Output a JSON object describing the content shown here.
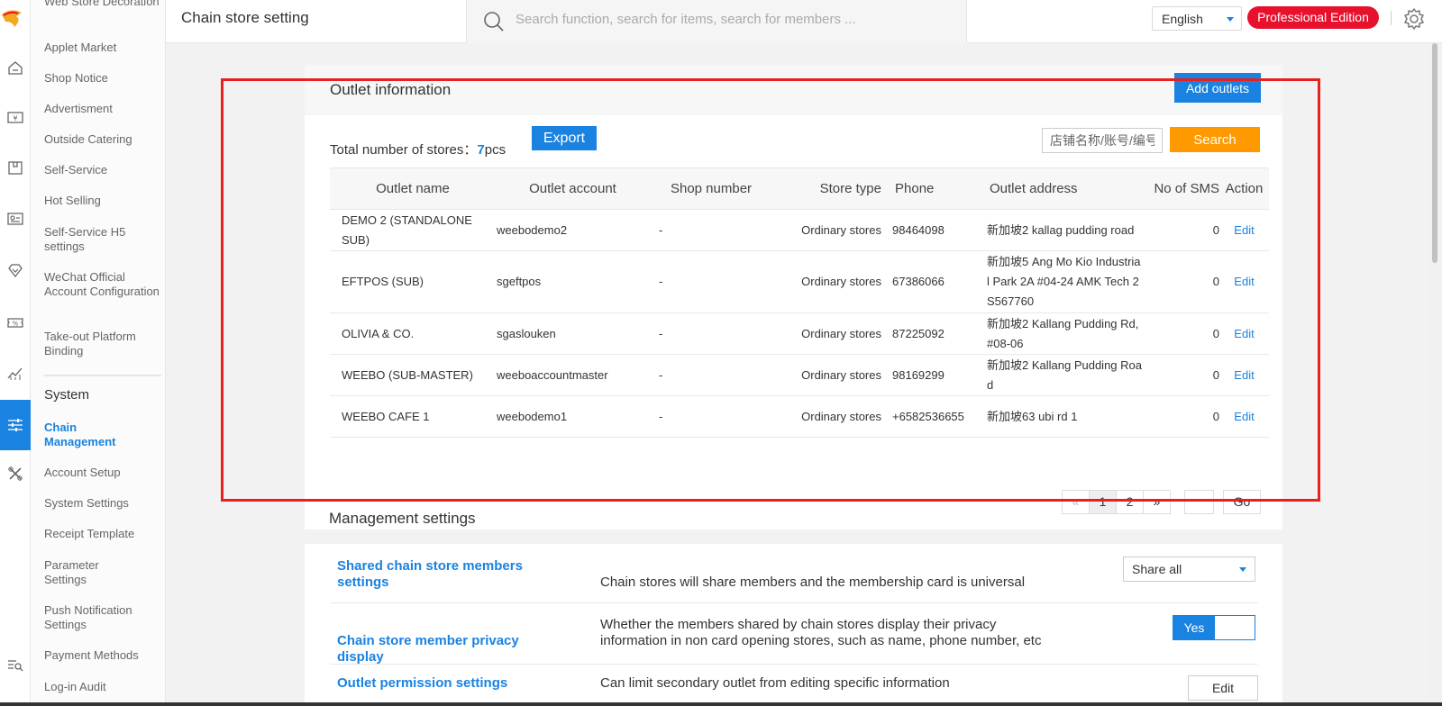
{
  "app": {
    "page_title": "Chain store setting"
  },
  "topbar": {
    "search_placeholder": "Search function, search for items, search for members ...",
    "language": "English",
    "edition": "Professional Edition"
  },
  "sidebar": {
    "items": [
      {
        "label": "Web Store Decoration"
      },
      {
        "label": "Applet Market"
      },
      {
        "label": "Shop Notice"
      },
      {
        "label": "Advertisment"
      },
      {
        "label": "Outside Catering"
      },
      {
        "label": "Self-Service"
      },
      {
        "label": "Hot Selling"
      },
      {
        "label": "Self-Service H5 settings"
      },
      {
        "label": "WeChat Official Account Configuration"
      },
      {
        "label": "Take-out Platform Binding"
      }
    ],
    "section_title": "System",
    "system_items": [
      {
        "label": "Chain Management",
        "active": true
      },
      {
        "label": "Account Setup"
      },
      {
        "label": "System Settings"
      },
      {
        "label": "Receipt Template"
      },
      {
        "label": "Parameter Settings"
      },
      {
        "label": "Push Notification Settings"
      },
      {
        "label": "Payment Methods"
      },
      {
        "label": "Log-in Audit"
      }
    ]
  },
  "outlet_info": {
    "title": "Outlet information",
    "add_button": "Add outlets",
    "total_label": "Total number of stores：",
    "total_count": "7",
    "total_unit": "pcs",
    "export_button": "Export",
    "search_placeholder": "店铺名称/账号/编号",
    "search_button": "Search",
    "columns": [
      "Outlet name",
      "Outlet account",
      "Shop number",
      "Store type",
      "Phone",
      "Outlet address",
      "No of SMS",
      "Action"
    ],
    "rows": [
      {
        "name": "DEMO 2 (STANDALONE SUB)",
        "account": "weebodemo2",
        "shop_no": "-",
        "type": "Ordinary stores",
        "phone": "98464098",
        "address": "新加坡2 kallag pudding road",
        "sms": "0",
        "action": "Edit"
      },
      {
        "name": "EFTPOS (SUB)",
        "account": "sgeftpos",
        "shop_no": "-",
        "type": "Ordinary stores",
        "phone": "67386066",
        "address": "新加坡5 Ang Mo Kio Industrial Park 2A #04-24 AMK Tech 2 S567760",
        "sms": "0",
        "action": "Edit"
      },
      {
        "name": "OLIVIA & CO.",
        "account": "sgaslouken",
        "shop_no": "-",
        "type": "Ordinary stores",
        "phone": "87225092",
        "address": "新加坡2 Kallang Pudding Rd, #08-06",
        "sms": "0",
        "action": "Edit"
      },
      {
        "name": "WEEBO (SUB-MASTER)",
        "account": "weeboaccountmaster",
        "shop_no": "-",
        "type": "Ordinary stores",
        "phone": "98169299",
        "address": "新加坡2 Kallang Pudding Road",
        "sms": "0",
        "action": "Edit"
      },
      {
        "name": "WEEBO CAFE 1",
        "account": "weebodemo1",
        "shop_no": "-",
        "type": "Ordinary stores",
        "phone": "+6582536655",
        "address": "新加坡63 ubi rd 1",
        "sms": "0",
        "action": "Edit"
      }
    ],
    "pagination": {
      "prev": "«",
      "pages": [
        "1",
        "2"
      ],
      "current": "1",
      "next": "»",
      "go": "Go"
    }
  },
  "management": {
    "title": "Management settings",
    "settings": [
      {
        "label": "Shared chain store members settings",
        "desc": "Chain stores will share members and the membership card is universal",
        "control": "Share all"
      },
      {
        "label": "Chain store member privacy display",
        "desc": "Whether the members shared by chain stores display their privacy information in non card opening stores, such as name, phone number, etc",
        "control": "Yes"
      },
      {
        "label": "Outlet permission settings",
        "desc": "Can limit secondary outlet from editing specific information",
        "control": "Edit"
      }
    ]
  },
  "colors": {
    "accent": "#1a82e0",
    "search_orange": "#ff9900",
    "edition_red": "#e8112d",
    "highlight_box": "#e82020"
  },
  "icons": [
    "logo-icon",
    "home-icon",
    "wallet-icon",
    "box-icon",
    "member-card-icon",
    "diamond-icon",
    "coupon-icon",
    "chart-icon",
    "settings-sliders-icon",
    "tools-icon",
    "filter-search-icon",
    "search-icon",
    "gear-icon"
  ]
}
